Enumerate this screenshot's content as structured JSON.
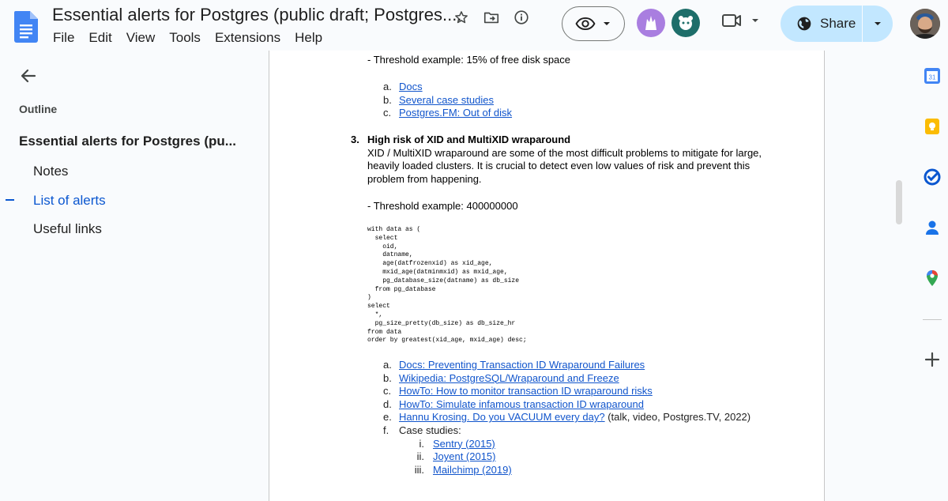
{
  "document": {
    "title": "Essential alerts for Postgres (public draft; Postgres...."
  },
  "menu": [
    "File",
    "Edit",
    "View",
    "Tools",
    "Extensions",
    "Help"
  ],
  "toolbar": {
    "share_label": "Share",
    "star_icon": "star-icon",
    "move_icon": "move-to-folder-icon",
    "status_icon": "document-status-icon"
  },
  "outline": {
    "label": "Outline",
    "heading": "Essential alerts for Postgres (pu...",
    "items": [
      {
        "label": "Notes",
        "active": false
      },
      {
        "label": "List of alerts",
        "active": true
      },
      {
        "label": "Useful links",
        "active": false
      }
    ]
  },
  "content": {
    "threshold_disk": "- Threshold example: 15% of free disk space",
    "disk_links": [
      {
        "marker": "a.",
        "text": "Docs"
      },
      {
        "marker": "b.",
        "text": "Several case studies"
      },
      {
        "marker": "c.",
        "text": "Postgres.FM: Out of disk"
      }
    ],
    "item3": {
      "number": "3.",
      "heading": "High risk of XID and MultiXID wraparound",
      "body_line1": "XID / MultiXID wraparound are some of the most difficult problems to mitigate for large,",
      "body_line2": "heavily loaded clusters. It is crucial to detect even low values of risk and prevent this",
      "body_line3": "problem from happening.",
      "threshold": "- Threshold example: 400000000"
    },
    "code": "with data as (\n  select\n    oid,\n    datname,\n    age(datfrozenxid) as xid_age,\n    mxid_age(datminmxid) as mxid_age,\n    pg_database_size(datname) as db_size\n  from pg_database\n)\nselect\n  *,\n  pg_size_pretty(db_size) as db_size_hr\nfrom data\norder by greatest(xid_age, mxid_age) desc;",
    "xid_links": [
      {
        "marker": "a.",
        "text": "Docs: Preventing Transaction ID Wraparound Failures",
        "suffix": ""
      },
      {
        "marker": "b.",
        "text": "Wikipedia: PostgreSQL/Wraparound and Freeze",
        "suffix": ""
      },
      {
        "marker": "c.",
        "text": "HowTo: How to monitor transaction ID wraparound risks",
        "suffix": ""
      },
      {
        "marker": "d.",
        "text": "HowTo: Simulate infamous transaction ID wraparound",
        "suffix": ""
      },
      {
        "marker": "e.",
        "text": "Hannu Krosing. Do you VACUUM every day?",
        "suffix": " (talk, video, Postgres.TV, 2022)"
      }
    ],
    "case_studies": {
      "marker": "f.",
      "label": "Case studies:",
      "items": [
        {
          "marker": "i.",
          "text": "Sentry (2015)"
        },
        {
          "marker": "ii.",
          "text": "Joyent (2015)"
        },
        {
          "marker": "iii.",
          "text": "Mailchimp (2019)"
        }
      ]
    }
  },
  "colors": {
    "accent": "#0b57d0",
    "share_bg": "#c2e7ff",
    "link": "#1155cc"
  }
}
